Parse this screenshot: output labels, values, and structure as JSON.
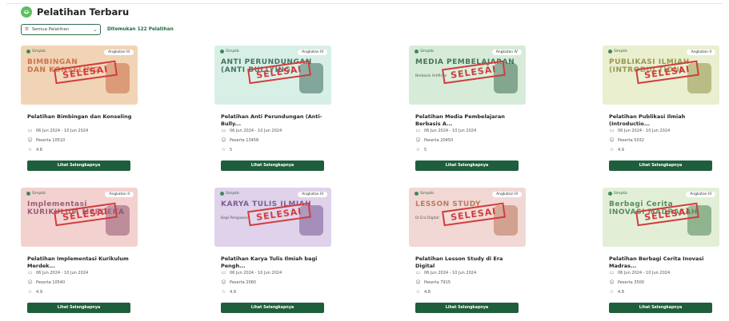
{
  "header": {
    "title": "Pelatihan Terbaru"
  },
  "filter": {
    "label": "Semua Pelatihan"
  },
  "found_text": "Ditemukan 122 Pelatihan",
  "thumb_brand": "Simpkb",
  "button_label": "Lihat Selengkapnya",
  "stamp_text": "SELESAI",
  "cards": [
    {
      "angkatan": "Angkatan III",
      "big1": "BIMBINGAN",
      "big2": "DAN KONSELING",
      "sub": "",
      "bg": "#f1d4b5",
      "textcolor": "#c6623c",
      "title": "Pelatihan Bimbingan dan Konseling",
      "date": "06 Jun 2024 - 10 Jun 2024",
      "peserta": "Peserta 10510",
      "rating": "4.8"
    },
    {
      "angkatan": "Angkatan III",
      "big1": "ANTI PERUNDUNGAN",
      "big2": "(ANTI BULLYING)",
      "sub": "",
      "bg": "#d8efe6",
      "textcolor": "#2c5e50",
      "title": "Pelatihan Anti Perundungan (Anti-Bully...",
      "date": "06 Jun 2024 - 10 Jun 2024",
      "peserta": "Peserta 13458",
      "rating": "5"
    },
    {
      "angkatan": "Angkatan IV",
      "big1": "MEDIA PEMBELAJARAN",
      "big2": "",
      "sub": "Berbasis Artificial",
      "bg": "#d6ecd8",
      "textcolor": "#2f5f46",
      "title": "Pelatihan Media Pembelajaran Berbasis A...",
      "date": "06 Jun 2024 - 10 Jun 2024",
      "peserta": "Peserta 20450",
      "rating": "5"
    },
    {
      "angkatan": "Angkatan II",
      "big1": "PUBLIKASI ILMIAH",
      "big2": "(INTRODUCTION)",
      "sub": "",
      "bg": "#e9efcf",
      "textcolor": "#8a8a3a",
      "title": "Pelatihan Publikasi Ilmiah (Introductio...",
      "date": "06 Jun 2024 - 10 Jun 2024",
      "peserta": "Peserta 5032",
      "rating": "4.9"
    },
    {
      "angkatan": "Angkatan II",
      "big1": "Implementasi",
      "big2": "KURIKULUM MERDEKA",
      "sub": "",
      "bg": "#f3d1cf",
      "textcolor": "#8a4a6a",
      "title": "Pelatihan Implementasi Kurikulum Merdek...",
      "date": "06 Jun 2024 - 10 Jun 2024",
      "peserta": "Peserta 10540",
      "rating": "4.9"
    },
    {
      "angkatan": "Angkatan III",
      "big1": "KARYA TULIS ILMIAH",
      "big2": "",
      "sub": "Bagi Pengawas",
      "bg": "#dfd2ea",
      "textcolor": "#6b4a8a",
      "title": "Pelatihan Karya Tulis Ilmiah bagi Pengh...",
      "date": "06 Jun 2024 - 10 Jun 2024",
      "peserta": "Peserta 2060",
      "rating": "4.9"
    },
    {
      "angkatan": "Angkatan III",
      "big1": "LESSON STUDY",
      "big2": "",
      "sub": "Di Era Digital",
      "bg": "#f1d8d4",
      "textcolor": "#b36a4a",
      "title": "Pelatihan Lesson Study di Era Digital",
      "date": "06 Jun 2024 - 10 Jun 2024",
      "peserta": "Peserta 7915",
      "rating": "4.8"
    },
    {
      "angkatan": "Angkatan III",
      "big1": "Berbagi Cerita",
      "big2": "INOVASI MADRASAH",
      "sub": "",
      "bg": "#e2efd6",
      "textcolor": "#3f7a4a",
      "title": "Pelatihan Berbagi Cerita Inovasi Madras...",
      "date": "06 Jun 2024 - 10 Jun 2024",
      "peserta": "Peserta 3500",
      "rating": "4.8"
    }
  ]
}
